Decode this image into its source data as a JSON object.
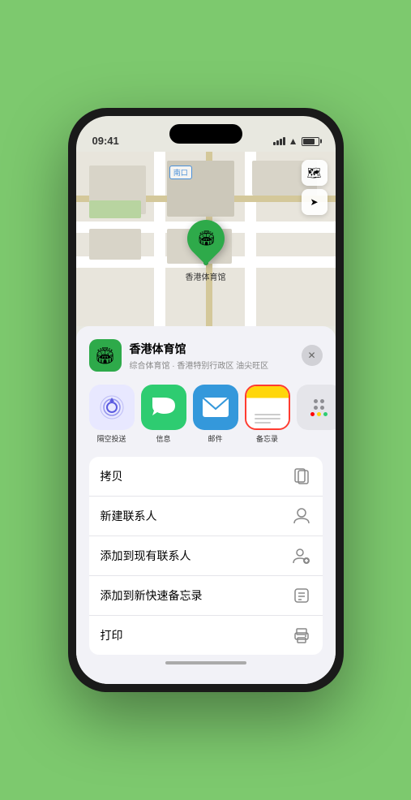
{
  "statusBar": {
    "time": "09:41",
    "locationIcon": "▶"
  },
  "map": {
    "label": "南口",
    "pinLabel": "香港体育馆",
    "controls": {
      "mapBtn": "🗺",
      "locationBtn": "➤"
    }
  },
  "venueCard": {
    "name": "香港体育馆",
    "subtitle": "综合体育馆 · 香港特别行政区 油尖旺区",
    "closeBtn": "✕"
  },
  "shareItems": [
    {
      "id": "airdrop",
      "label": "隔空投送",
      "emoji": "📡"
    },
    {
      "id": "message",
      "label": "信息",
      "emoji": "💬"
    },
    {
      "id": "mail",
      "label": "邮件",
      "emoji": "✉️"
    },
    {
      "id": "notes",
      "label": "备忘录"
    },
    {
      "id": "more",
      "label": ""
    }
  ],
  "menuItems": [
    {
      "id": "copy",
      "label": "拷贝",
      "icon": "copy"
    },
    {
      "id": "new-contact",
      "label": "新建联系人",
      "icon": "person"
    },
    {
      "id": "add-existing",
      "label": "添加到现有联系人",
      "icon": "person-add"
    },
    {
      "id": "add-note",
      "label": "添加到新快速备忘录",
      "icon": "note"
    },
    {
      "id": "print",
      "label": "打印",
      "icon": "print"
    }
  ]
}
